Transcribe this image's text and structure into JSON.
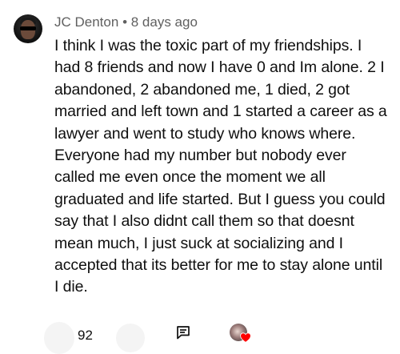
{
  "comment": {
    "author": "JC Denton",
    "separator": "•",
    "time": "8 days ago",
    "text": "I think I was the toxic part of my friendships. I had 8 friends and now I have 0 and Im alone. 2 I abandoned, 2 abandoned me, 1 died, 2 got married and left town and 1 started a career as a lawyer and went to study who knows where. Everyone had my number but nobody ever called me even once the moment we all graduated and life started. But I guess you could say that I also didnt call them so that doesnt mean much, I just suck at socializing and I accepted that its better for me to stay alone until I die.",
    "like_count": "92"
  },
  "icons": {
    "avatar": "user-avatar",
    "like": "thumbs-up-icon",
    "dislike": "thumbs-down-icon",
    "reply": "reply-comment-icon",
    "creator_heart": "creator-heart-icon"
  },
  "colors": {
    "text": "#0f0f0f",
    "secondary_text": "#606060",
    "heart": "#ff0000"
  }
}
